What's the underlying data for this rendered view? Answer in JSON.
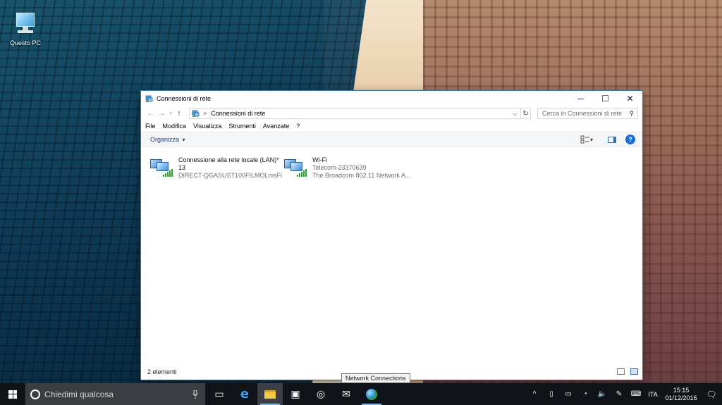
{
  "desktop": {
    "icons": [
      {
        "label": "Questo PC",
        "icon": "computer-icon"
      }
    ]
  },
  "window": {
    "title": "Connessioni di rete",
    "controls": {
      "minimize": "─",
      "maximize": "☐",
      "close": "✕"
    },
    "address": {
      "back": "←",
      "forward": "→",
      "recent": "˅",
      "up": "↑",
      "separator": ">",
      "path": "Connessioni di rete",
      "dropdown": "⌵",
      "refresh": "↻"
    },
    "search": {
      "placeholder": "Cerca in Connessioni di rete",
      "icon": "⚲"
    },
    "menu": [
      "File",
      "Modifica",
      "Visualizza",
      "Strumenti",
      "Avanzate",
      "?"
    ],
    "toolbar": {
      "organize": "Organizza",
      "organize_arrow": "▾",
      "view_arrow": "▾",
      "help": "?"
    },
    "connections": [
      {
        "name": "Connessione alla rete locale (LAN)*",
        "name2": "13",
        "detail": "DIRECT-QGASUST100FILMOLmsFi"
      },
      {
        "name": "Wi-Fi",
        "network": "Telecom-23370639",
        "adapter": "The Broadcom 802.11 Network A..."
      }
    ],
    "status": "2 elementi"
  },
  "tooltip": "Network Connections",
  "taskbar": {
    "search_placeholder": "Chiedimi qualcosa",
    "apps": [
      {
        "name": "task-view-icon",
        "glyph": "▭"
      },
      {
        "name": "edge-icon",
        "glyph": "e"
      },
      {
        "name": "file-explorer-icon",
        "glyph": ""
      },
      {
        "name": "store-icon",
        "glyph": "▣"
      },
      {
        "name": "groove-icon",
        "glyph": "◎"
      },
      {
        "name": "mail-icon",
        "glyph": "✉"
      },
      {
        "name": "network-globe-icon",
        "glyph": ""
      }
    ],
    "tray": {
      "chevron": "^",
      "language": "ITA",
      "time": "15:15",
      "date": "01/12/2016"
    }
  }
}
